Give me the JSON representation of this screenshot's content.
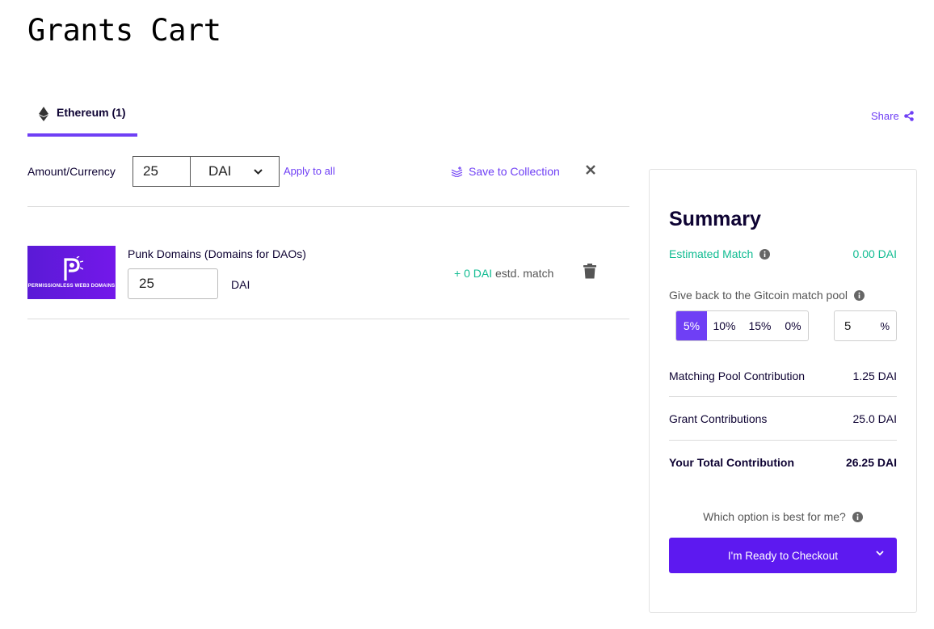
{
  "page": {
    "title": "Grants Cart"
  },
  "tabs": [
    {
      "label": "Ethereum (1)",
      "icon": "ethereum-icon"
    }
  ],
  "share": {
    "label": "Share",
    "icon": "share-icon"
  },
  "amount_bar": {
    "label": "Amount/Currency",
    "amount": "25",
    "currency": "DAI",
    "apply_all": "Apply to all",
    "save_collection": "Save to Collection"
  },
  "grants": [
    {
      "title": "Punk Domains (Domains for DAOs)",
      "logo_text": "PERMISSIONLESS WEB3 DOMAINS",
      "amount": "25",
      "currency": "DAI",
      "match_value": "+ 0 DAI",
      "match_suffix": " estd. match"
    }
  ],
  "summary": {
    "title": "Summary",
    "estimated_match_label": "Estimated Match",
    "estimated_match_value": "0.00 DAI",
    "giveback_label": "Give back to the Gitcoin match pool",
    "percent_options": [
      "5%",
      "10%",
      "15%",
      "0%"
    ],
    "selected_percent": "5%",
    "custom_percent": "5",
    "percent_sign": "%",
    "rows": [
      {
        "label": "Matching Pool Contribution",
        "value": "1.25 DAI"
      },
      {
        "label": "Grant Contributions",
        "value": "25.0 DAI"
      },
      {
        "label": "Your Total Contribution",
        "value": "26.25 DAI"
      }
    ],
    "which_option": "Which option is best for me?",
    "checkout_label": "I'm Ready to Checkout"
  },
  "colors": {
    "accent": "#6f3ff5",
    "match_green": "#11bc92",
    "checkout": "#5d19f0"
  }
}
